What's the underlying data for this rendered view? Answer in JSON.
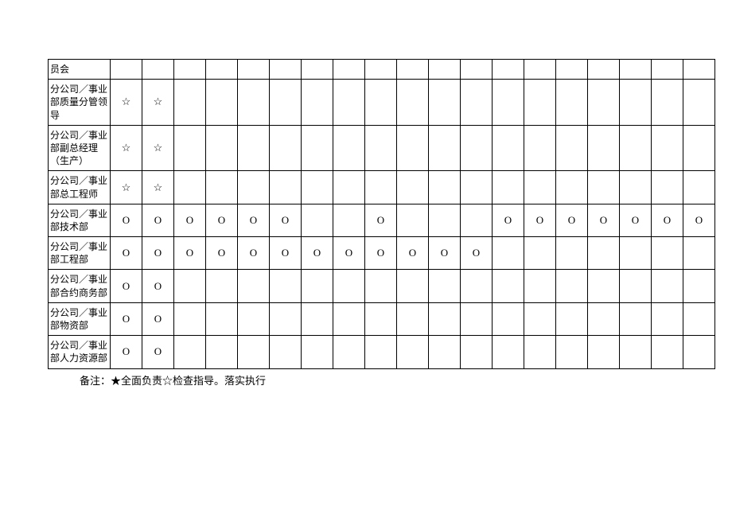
{
  "rows": [
    {
      "label": "员会",
      "cells": [
        "",
        "",
        "",
        "",
        "",
        "",
        "",
        "",
        "",
        "",
        "",
        "",
        "",
        "",
        "",
        "",
        "",
        "",
        ""
      ]
    },
    {
      "label": "分公司／事业部质量分管领导",
      "cells": [
        "☆",
        "☆",
        "",
        "",
        "",
        "",
        "",
        "",
        "",
        "",
        "",
        "",
        "",
        "",
        "",
        "",
        "",
        "",
        ""
      ]
    },
    {
      "label": "分公司／事业部副总经理（生产）",
      "cells": [
        "☆",
        "☆",
        "",
        "",
        "",
        "",
        "",
        "",
        "",
        "",
        "",
        "",
        "",
        "",
        "",
        "",
        "",
        "",
        ""
      ]
    },
    {
      "label": "分公司／事业部总工程师",
      "cells": [
        "☆",
        "☆",
        "",
        "",
        "",
        "",
        "",
        "",
        "",
        "",
        "",
        "",
        "",
        "",
        "",
        "",
        "",
        "",
        ""
      ]
    },
    {
      "label": "分公司／事业部技术部",
      "cells": [
        "O",
        "O",
        "O",
        "O",
        "O",
        "O",
        "",
        "",
        "O",
        "",
        "",
        "",
        "O",
        "O",
        "O",
        "O",
        "O",
        "O",
        "O"
      ]
    },
    {
      "label": "分公司／事业部工程部",
      "cells": [
        "O",
        "O",
        "O",
        "O",
        "O",
        "O",
        "O",
        "O",
        "O",
        "O",
        "O",
        "O",
        "",
        "",
        "",
        "",
        "",
        "",
        ""
      ]
    },
    {
      "label": "分公司／事业部合约商务部",
      "cells": [
        "O",
        "O",
        "",
        "",
        "",
        "",
        "",
        "",
        "",
        "",
        "",
        "",
        "",
        "",
        "",
        "",
        "",
        "",
        ""
      ]
    },
    {
      "label": "分公司／事业部物资部",
      "cells": [
        "O",
        "O",
        "",
        "",
        "",
        "",
        "",
        "",
        "",
        "",
        "",
        "",
        "",
        "",
        "",
        "",
        "",
        "",
        ""
      ]
    },
    {
      "label": "分公司／事业部人力资源部",
      "cells": [
        "O",
        "O",
        "",
        "",
        "",
        "",
        "",
        "",
        "",
        "",
        "",
        "",
        "",
        "",
        "",
        "",
        "",
        "",
        ""
      ]
    }
  ],
  "rowHeights": [
    "short",
    "tall",
    "tall",
    "med",
    "med",
    "med",
    "med",
    "med",
    "med"
  ],
  "note": "备注：★全面负责☆检查指导。落实执行"
}
